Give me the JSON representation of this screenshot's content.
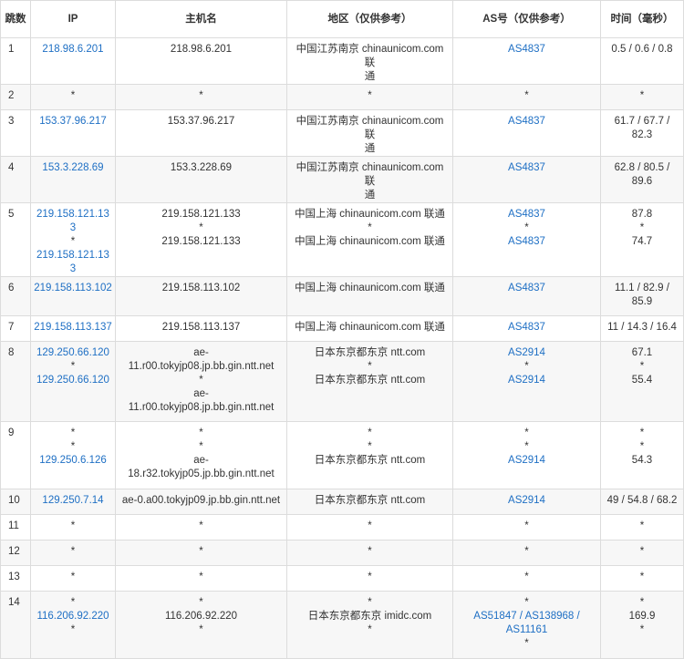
{
  "headers": {
    "hop": "跳数",
    "ip": "IP",
    "host": "主机名",
    "region": "地区（仅供参考）",
    "as": "AS号（仅供参考）",
    "time": "时间（毫秒）"
  },
  "colors": {
    "link": "#1e6fc4",
    "stripe": "#f7f7f7",
    "border": "#dcdcdc"
  },
  "rows": [
    {
      "hop": "1",
      "ip": [
        "218.98.6.201"
      ],
      "host": [
        "218.98.6.201"
      ],
      "region": [
        "中国江苏南京 chinaunicom.com 联",
        "通"
      ],
      "as": [
        "AS4837"
      ],
      "time": [
        "0.5 / 0.6 / 0.8"
      ]
    },
    {
      "hop": "2",
      "ip": [
        "*"
      ],
      "host": [
        "*"
      ],
      "region": [
        "*"
      ],
      "as": [
        "*"
      ],
      "time": [
        "*"
      ]
    },
    {
      "hop": "3",
      "ip": [
        "153.37.96.217"
      ],
      "host": [
        "153.37.96.217"
      ],
      "region": [
        "中国江苏南京 chinaunicom.com 联",
        "通"
      ],
      "as": [
        "AS4837"
      ],
      "time": [
        "61.7 / 67.7 /",
        "82.3"
      ]
    },
    {
      "hop": "4",
      "ip": [
        "153.3.228.69"
      ],
      "host": [
        "153.3.228.69"
      ],
      "region": [
        "中国江苏南京 chinaunicom.com 联",
        "通"
      ],
      "as": [
        "AS4837"
      ],
      "time": [
        "62.8 / 80.5 /",
        "89.6"
      ]
    },
    {
      "hop": "5",
      "ip": [
        "219.158.121.133",
        "*",
        "219.158.121.133"
      ],
      "host": [
        "219.158.121.133",
        "*",
        "219.158.121.133"
      ],
      "region": [
        "中国上海 chinaunicom.com 联通",
        "*",
        "中国上海 chinaunicom.com 联通"
      ],
      "as": [
        "AS4837",
        "*",
        "AS4837"
      ],
      "time": [
        "87.8",
        "*",
        "74.7"
      ]
    },
    {
      "hop": "6",
      "ip": [
        "219.158.113.102"
      ],
      "host": [
        "219.158.113.102"
      ],
      "region": [
        "中国上海 chinaunicom.com 联通"
      ],
      "as": [
        "AS4837"
      ],
      "time": [
        "11.1 / 82.9 /",
        "85.9"
      ]
    },
    {
      "hop": "7",
      "ip": [
        "219.158.113.137"
      ],
      "host": [
        "219.158.113.137"
      ],
      "region": [
        "中国上海 chinaunicom.com 联通"
      ],
      "as": [
        "AS4837"
      ],
      "time": [
        "11 / 14.3 / 16.4"
      ]
    },
    {
      "hop": "8",
      "ip": [
        "129.250.66.120",
        "*",
        "129.250.66.120"
      ],
      "host": [
        "ae-",
        "11.r00.tokyjp08.jp.bb.gin.ntt.net",
        "*",
        "ae-",
        "11.r00.tokyjp08.jp.bb.gin.ntt.net"
      ],
      "region": [
        "日本东京都东京 ntt.com",
        "*",
        "日本东京都东京 ntt.com"
      ],
      "as": [
        "AS2914",
        "*",
        "AS2914"
      ],
      "time": [
        "67.1",
        "*",
        "55.4"
      ]
    },
    {
      "hop": "9",
      "ip": [
        "*",
        "*",
        "129.250.6.126"
      ],
      "host": [
        "*",
        "*",
        "ae-",
        "18.r32.tokyjp05.jp.bb.gin.ntt.net"
      ],
      "region": [
        "*",
        "*",
        "日本东京都东京 ntt.com"
      ],
      "as": [
        "*",
        "*",
        "AS2914"
      ],
      "time": [
        "*",
        "*",
        "54.3"
      ]
    },
    {
      "hop": "10",
      "ip": [
        "129.250.7.14"
      ],
      "host": [
        "ae-0.a00.tokyjp09.jp.bb.gin.ntt.net"
      ],
      "region": [
        "日本东京都东京 ntt.com"
      ],
      "as": [
        "AS2914"
      ],
      "time": [
        "49 / 54.8 / 68.2"
      ]
    },
    {
      "hop": "11",
      "ip": [
        "*"
      ],
      "host": [
        "*"
      ],
      "region": [
        "*"
      ],
      "as": [
        "*"
      ],
      "time": [
        "*"
      ]
    },
    {
      "hop": "12",
      "ip": [
        "*"
      ],
      "host": [
        "*"
      ],
      "region": [
        "*"
      ],
      "as": [
        "*"
      ],
      "time": [
        "*"
      ]
    },
    {
      "hop": "13",
      "ip": [
        "*"
      ],
      "host": [
        "*"
      ],
      "region": [
        "*"
      ],
      "as": [
        "*"
      ],
      "time": [
        "*"
      ]
    },
    {
      "hop": "14",
      "ip": [
        "*",
        "116.206.92.220",
        "*"
      ],
      "host": [
        "*",
        "116.206.92.220",
        "*"
      ],
      "region": [
        "*",
        "日本东京都东京 imidc.com",
        "*"
      ],
      "as": [
        "*",
        "AS51847 / AS138968 /",
        "AS11161",
        "*"
      ],
      "time": [
        "*",
        "169.9",
        "*"
      ]
    }
  ]
}
